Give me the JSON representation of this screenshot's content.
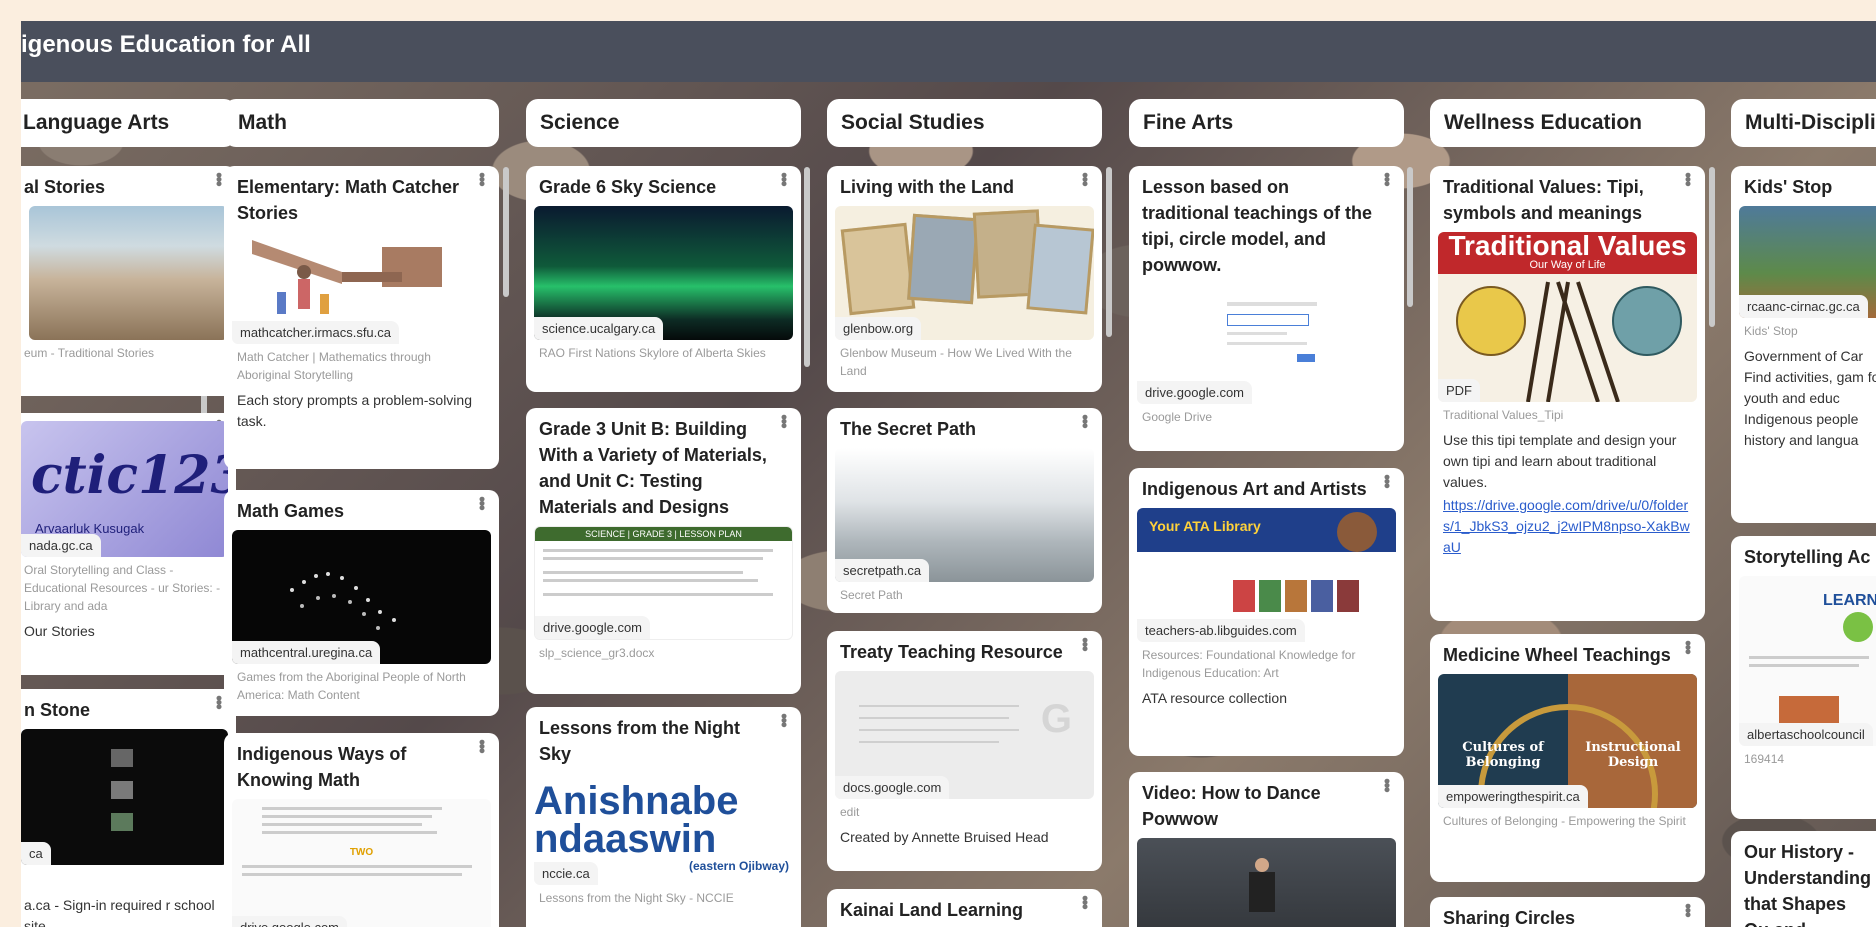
{
  "board": {
    "title": "igenous Education for All"
  },
  "columns": [
    {
      "header": "Language Arts"
    },
    {
      "header": "Math"
    },
    {
      "header": "Science"
    },
    {
      "header": "Social Studies"
    },
    {
      "header": "Fine Arts"
    },
    {
      "header": "Wellness Education"
    },
    {
      "header": "Multi-Discipli"
    }
  ],
  "cards": {
    "la1": {
      "title": "al Stories",
      "meta": "eum - Traditional Stories"
    },
    "la2": {
      "domain": "nada.gc.ca",
      "meta": "Oral Storytelling and Class - Educational Resources - ur Stories: - Library and ada",
      "desc": "Our Stories",
      "thumb_text": "Arvaarluk Kusugak"
    },
    "la3": {
      "title": "n Stone",
      "domain": "ca",
      "desc": "a.ca - Sign-in required r school site."
    },
    "m1": {
      "title": "Elementary: Math Catcher Stories",
      "domain": "mathcatcher.irmacs.sfu.ca",
      "meta": "Math Catcher | Mathematics through Aboriginal Storytelling",
      "desc": "Each story prompts a problem-solving task."
    },
    "m2": {
      "title": "Math Games",
      "domain": "mathcentral.uregina.ca",
      "meta": "Games from the Aboriginal People of North America: Math Content"
    },
    "m3": {
      "title": "Indigenous Ways of Knowing Math",
      "domain": "drive.google.com",
      "thumb_word": "TWO"
    },
    "s1": {
      "title": "Grade 6 Sky Science",
      "domain": "science.ucalgary.ca",
      "meta": "RAO First Nations Skylore of Alberta Skies"
    },
    "s2": {
      "title": "Grade 3 Unit B: Building With a Variety of Materials, and Unit C: Testing Materials and Designs",
      "domain": "drive.google.com",
      "meta": "slp_science_gr3.docx",
      "thumb_banner": "SCIENCE | GRADE 3 | LESSON PLAN"
    },
    "s3": {
      "title": "Lessons from the Night Sky",
      "domain": "nccie.ca",
      "meta": "Lessons from the Night Sky - NCCIE",
      "thumb_line1": "Anishnabe",
      "thumb_line2": "ndaaswin",
      "thumb_line3": "(eastern Ojibway)"
    },
    "ss1": {
      "title": "Living with the Land",
      "domain": "glenbow.org",
      "meta": "Glenbow Museum - How We Lived With the Land"
    },
    "ss2": {
      "title": "The Secret Path",
      "domain": "secretpath.ca",
      "meta": "Secret Path"
    },
    "ss3": {
      "title": "Treaty Teaching Resource",
      "domain": "docs.google.com",
      "meta": "edit",
      "desc": "Created by Annette Bruised Head"
    },
    "ss4": {
      "title": "Kainai Land Learning"
    },
    "fa1": {
      "title": "Lesson based on traditional teachings of the tipi, circle model, and powwow.",
      "domain": "drive.google.com",
      "meta": "Google Drive"
    },
    "fa2": {
      "title": "Indigenous Art and Artists",
      "domain": "teachers-ab.libguides.com",
      "meta": "Resources: Foundational Knowledge for Indigenous Education: Art",
      "desc": "ATA resource collection",
      "thumb_banner": "Your ATA Library"
    },
    "fa3": {
      "title": "Video: How to Dance Powwow"
    },
    "w1": {
      "title": "Traditional Values: Tipi, symbols and meanings",
      "domain": "PDF",
      "meta": "Traditional Values_Tipi",
      "desc": "Use this tipi template and design your own tipi and learn about traditional values.",
      "link": "https://drive.google.com/drive/u/0/folders/1_JbkS3_ojzu2_j2wIPM8npso-XakBwaU",
      "thumb_title": "Traditional Values",
      "thumb_sub": "Our Way of Life"
    },
    "w2": {
      "title": "Medicine Wheel Teachings",
      "domain": "empoweringthespirit.ca",
      "meta": "Cultures of Belonging - Empowering the Spirit",
      "thumb_left": "Cultures of Belonging",
      "thumb_right": "Instructional Design"
    },
    "w3": {
      "title": "Sharing Circles"
    },
    "md1": {
      "title": "Kids' Stop",
      "domain": "rcaanc-cirnac.gc.ca",
      "meta": "Kids' Stop",
      "desc": "Government of Car Find activities, gam for youth and educ Indigenous people history and langua"
    },
    "md2": {
      "title": "Storytelling Ac Curriculum",
      "domain": "albertaschoolcouncil",
      "meta": "169414",
      "thumb_word": "LEARN"
    },
    "md3": {
      "title": "Our History - Understanding that Shapes Ou and Informs Ou"
    }
  },
  "colors": {
    "topbar": "#4a4f5c",
    "card": "#ffffff",
    "page_margin": "#fbeedf",
    "link": "#2a5ccc"
  }
}
